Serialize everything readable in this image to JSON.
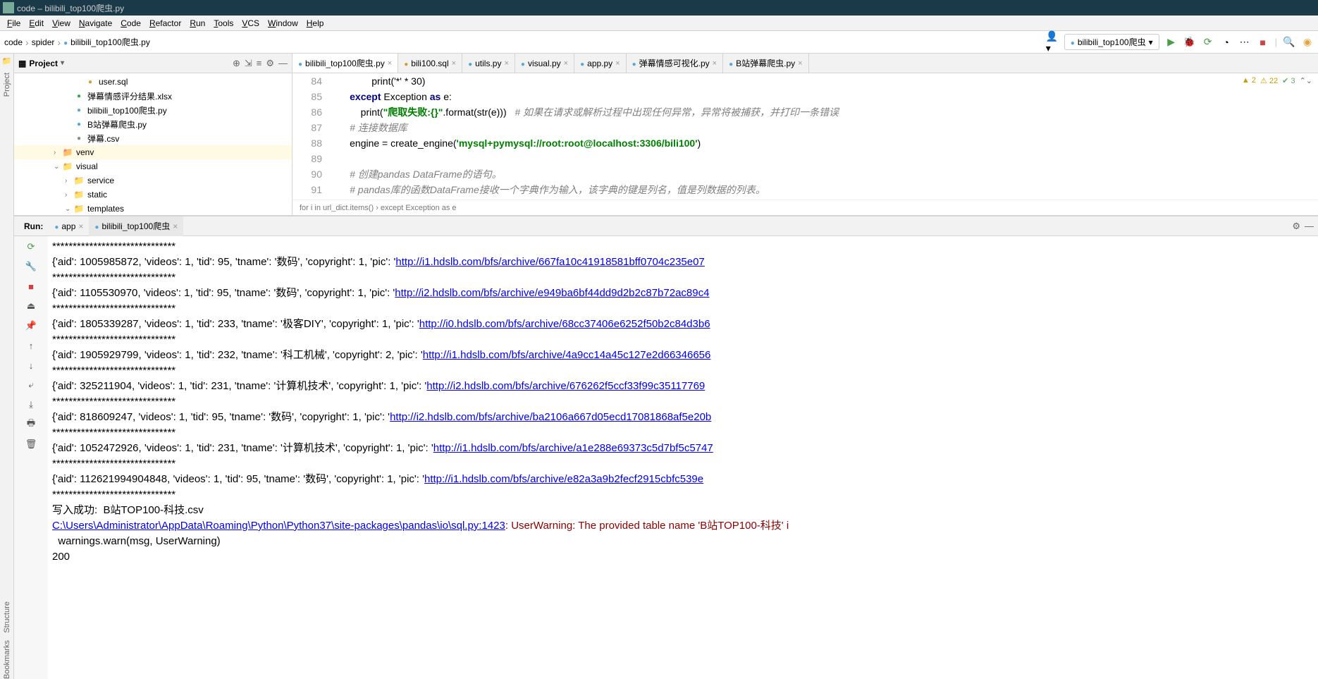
{
  "window": {
    "title": "code – bilibili_top100爬虫.py"
  },
  "menu": [
    "File",
    "Edit",
    "View",
    "Navigate",
    "Code",
    "Refactor",
    "Run",
    "Tools",
    "VCS",
    "Window",
    "Help"
  ],
  "breadcrumb": {
    "root": "code",
    "mid": "spider",
    "file": "bilibili_top100爬虫.py"
  },
  "run_config": {
    "label": "bilibili_top100爬虫"
  },
  "project_panel": {
    "title": "Project",
    "tree": [
      {
        "indent": 5,
        "icon": "sql-icon",
        "label": "user.sql"
      },
      {
        "indent": 4,
        "icon": "xlsx-icon",
        "label": "弹幕情感评分结果.xlsx"
      },
      {
        "indent": 4,
        "icon": "py-icon",
        "label": "bilibili_top100爬虫.py"
      },
      {
        "indent": 4,
        "icon": "py-icon",
        "label": "B站弹幕爬虫.py"
      },
      {
        "indent": 4,
        "icon": "csv-icon",
        "label": "弹幕.csv"
      },
      {
        "indent": 3,
        "icon": "folder-orange",
        "label": "venv",
        "arrow": "›",
        "sel": true
      },
      {
        "indent": 3,
        "icon": "folder-icon",
        "label": "visual",
        "arrow": "⌄"
      },
      {
        "indent": 4,
        "icon": "folder-icon",
        "label": "service",
        "arrow": "›"
      },
      {
        "indent": 4,
        "icon": "folder-icon",
        "label": "static",
        "arrow": "›"
      },
      {
        "indent": 4,
        "icon": "folder-icon",
        "label": "templates",
        "arrow": "⌄"
      }
    ]
  },
  "editor": {
    "tabs": [
      {
        "label": "bilibili_top100爬虫.py",
        "icon": "py-icon",
        "active": true
      },
      {
        "label": "bili100.sql",
        "icon": "sql-icon"
      },
      {
        "label": "utils.py",
        "icon": "py-icon"
      },
      {
        "label": "visual.py",
        "icon": "py-icon"
      },
      {
        "label": "app.py",
        "icon": "py-icon"
      },
      {
        "label": "弹幕情感可视化.py",
        "icon": "py-icon"
      },
      {
        "label": "B站弹幕爬虫.py",
        "icon": "py-icon"
      }
    ],
    "indicators": {
      "a": "2",
      "b": "22",
      "c": "3"
    },
    "lines": [
      {
        "n": "84",
        "html": "                print('*' * 30)"
      },
      {
        "n": "85",
        "html": "        <span class='kw'>except</span> Exception <span class='kw'>as</span> e:"
      },
      {
        "n": "86",
        "html": "            print(<span class='str'>\"爬取失败:{}\"</span>.format(str(e)))   <span class='com'># 如果在请求或解析过程中出现任何异常，异常将被捕获，并打印一条错误</span>"
      },
      {
        "n": "87",
        "html": "        <span class='com'># 连接数据库</span>"
      },
      {
        "n": "88",
        "html": "        engine = create_engine(<span class='str'>'mysql+pymysql://root:root@localhost:3306/bili100'</span>)"
      },
      {
        "n": "89",
        "html": ""
      },
      {
        "n": "90",
        "html": "        <span class='com'># 创建pandas DataFrame的语句。</span>"
      },
      {
        "n": "91",
        "html": "        <span class='com'># pandas库的函数DataFrame接收一个字典作为输入，该字典的键是列名，值是列数据的列表。</span>"
      }
    ],
    "context": "for i in url_dict.items()  ›  except Exception as e"
  },
  "run_panel": {
    "title": "Run:",
    "tabs": [
      {
        "label": "app",
        "icon": "py-icon"
      },
      {
        "label": "bilibili_top100爬虫",
        "icon": "py-icon",
        "active": true
      }
    ],
    "console": [
      {
        "t": "plain",
        "text": "******************************"
      },
      {
        "t": "dict",
        "prefix": "{'aid': 1005985872, 'videos': 1, 'tid': 95, 'tname': '数码', 'copyright': 1, 'pic': '",
        "link": "http://i1.hdslb.com/bfs/archive/667fa10c41918581bff0704c235e07"
      },
      {
        "t": "plain",
        "text": "******************************"
      },
      {
        "t": "dict",
        "prefix": "{'aid': 1105530970, 'videos': 1, 'tid': 95, 'tname': '数码', 'copyright': 1, 'pic': '",
        "link": "http://i2.hdslb.com/bfs/archive/e949ba6bf44dd9d2b2c87b72ac89c4"
      },
      {
        "t": "plain",
        "text": "******************************"
      },
      {
        "t": "dict",
        "prefix": "{'aid': 1805339287, 'videos': 1, 'tid': 233, 'tname': '极客DIY', 'copyright': 1, 'pic': '",
        "link": "http://i0.hdslb.com/bfs/archive/68cc37406e6252f50b2c84d3b6"
      },
      {
        "t": "plain",
        "text": "******************************"
      },
      {
        "t": "dict",
        "prefix": "{'aid': 1905929799, 'videos': 1, 'tid': 232, 'tname': '科工机械', 'copyright': 2, 'pic': '",
        "link": "http://i1.hdslb.com/bfs/archive/4a9cc14a45c127e2d66346656"
      },
      {
        "t": "plain",
        "text": "******************************"
      },
      {
        "t": "dict",
        "prefix": "{'aid': 325211904, 'videos': 1, 'tid': 231, 'tname': '计算机技术', 'copyright': 1, 'pic': '",
        "link": "http://i2.hdslb.com/bfs/archive/676262f5ccf33f99c35117769"
      },
      {
        "t": "plain",
        "text": "******************************"
      },
      {
        "t": "dict",
        "prefix": "{'aid': 818609247, 'videos': 1, 'tid': 95, 'tname': '数码', 'copyright': 1, 'pic': '",
        "link": "http://i2.hdslb.com/bfs/archive/ba2106a667d05ecd17081868af5e20b"
      },
      {
        "t": "plain",
        "text": "******************************"
      },
      {
        "t": "dict",
        "prefix": "{'aid': 1052472926, 'videos': 1, 'tid': 231, 'tname': '计算机技术', 'copyright': 1, 'pic': '",
        "link": "http://i1.hdslb.com/bfs/archive/a1e288e69373c5d7bf5c5747"
      },
      {
        "t": "plain",
        "text": "******************************"
      },
      {
        "t": "dict",
        "prefix": "{'aid': 112621994904848, 'videos': 1, 'tid': 95, 'tname': '数码', 'copyright': 1, 'pic': '",
        "link": "http://i1.hdslb.com/bfs/archive/e82a3a9b2fecf2915cbfc539e"
      },
      {
        "t": "plain",
        "text": "******************************"
      },
      {
        "t": "plain",
        "text": "写入成功:  B站TOP100-科技.csv"
      },
      {
        "t": "warnpath",
        "link": "C:\\Users\\Administrator\\AppData\\Roaming\\Python\\Python37\\site-packages\\pandas\\io\\sql.py:1423",
        "rest": ": UserWarning: The provided table name 'B站TOP100-科技' i"
      },
      {
        "t": "plain",
        "text": "  warnings.warn(msg, UserWarning)"
      },
      {
        "t": "plain",
        "text": "200"
      }
    ]
  },
  "sidebar_labels": {
    "project": "Project",
    "structure": "Structure",
    "bookmarks": "Bookmarks"
  }
}
